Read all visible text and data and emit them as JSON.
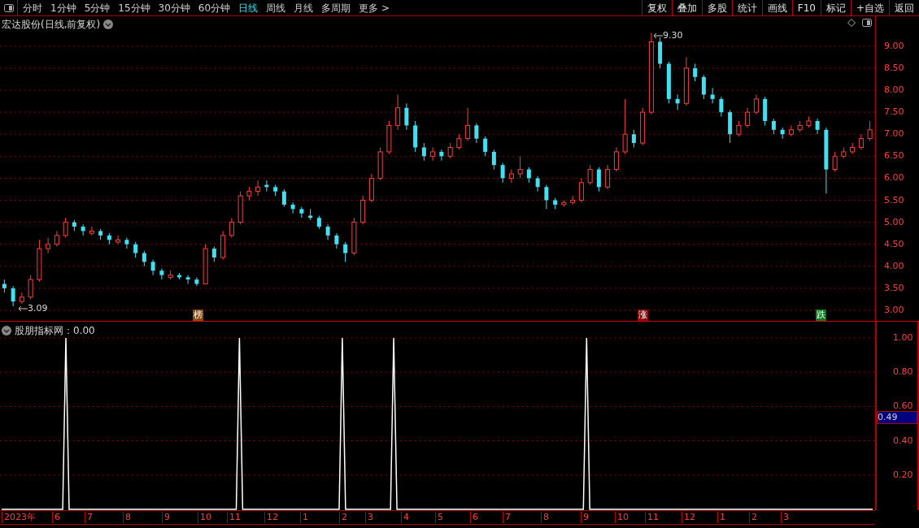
{
  "toolbar": {
    "periods": [
      {
        "label": "分时",
        "selected": false
      },
      {
        "label": "1分钟",
        "selected": false
      },
      {
        "label": "5分钟",
        "selected": false
      },
      {
        "label": "15分钟",
        "selected": false
      },
      {
        "label": "30分钟",
        "selected": false
      },
      {
        "label": "60分钟",
        "selected": false
      },
      {
        "label": "日线",
        "selected": true
      },
      {
        "label": "周线",
        "selected": false
      },
      {
        "label": "月线",
        "selected": false
      },
      {
        "label": "多周期",
        "selected": false
      },
      {
        "label": "更多 >",
        "selected": false
      }
    ],
    "actions": [
      "复权",
      "叠加",
      "多股",
      "统计",
      "画线",
      "F10",
      "标记",
      "+自选",
      "返回"
    ]
  },
  "price_panel": {
    "title": "宏达股份(日线,前复权)",
    "high_label": "9.30",
    "low_label": "3.09",
    "badges": [
      {
        "text": "榜",
        "color": "#8b4a0a"
      },
      {
        "text": "涨",
        "color": "#8b0a0a"
      },
      {
        "text": "跌",
        "color": "#0a7a1a"
      }
    ],
    "chart_data": {
      "type": "candlestick",
      "ylim": [
        2.76,
        9.68
      ],
      "grid": true,
      "yticks": [
        {
          "value": 3,
          "label": "3.00"
        },
        {
          "value": 3.5,
          "label": "3.50"
        },
        {
          "value": 4,
          "label": "4.00"
        },
        {
          "value": 4.5,
          "label": "4.50"
        },
        {
          "value": 5,
          "label": "5.00"
        },
        {
          "value": 5.5,
          "label": "5.50"
        },
        {
          "value": 6,
          "label": "6.00"
        },
        {
          "value": 6.5,
          "label": "6.50"
        },
        {
          "value": 7,
          "label": "7.00"
        },
        {
          "value": 7.5,
          "label": "7.50"
        },
        {
          "value": 8,
          "label": "8.00"
        },
        {
          "value": 8.5,
          "label": "8.50"
        },
        {
          "value": 9,
          "label": "9.00"
        }
      ],
      "ohlc": [
        [
          3.6,
          3.7,
          3.4,
          3.5
        ],
        [
          3.5,
          3.55,
          3.09,
          3.2
        ],
        [
          3.2,
          3.4,
          3.15,
          3.3
        ],
        [
          3.3,
          3.8,
          3.25,
          3.7
        ],
        [
          3.7,
          4.6,
          3.65,
          4.4
        ],
        [
          4.4,
          4.65,
          4.3,
          4.5
        ],
        [
          4.5,
          4.8,
          4.45,
          4.7
        ],
        [
          4.7,
          5.1,
          4.65,
          5.0
        ],
        [
          5.0,
          5.05,
          4.8,
          4.9
        ],
        [
          4.9,
          4.95,
          4.7,
          4.8
        ],
        [
          4.75,
          4.9,
          4.7,
          4.8
        ],
        [
          4.8,
          4.85,
          4.6,
          4.7
        ],
        [
          4.7,
          4.75,
          4.5,
          4.6
        ],
        [
          4.55,
          4.7,
          4.5,
          4.6
        ],
        [
          4.6,
          4.65,
          4.4,
          4.5
        ],
        [
          4.5,
          4.55,
          4.2,
          4.3
        ],
        [
          4.3,
          4.35,
          4.0,
          4.1
        ],
        [
          4.1,
          4.15,
          3.8,
          3.9
        ],
        [
          3.9,
          3.95,
          3.7,
          3.8
        ],
        [
          3.75,
          3.9,
          3.7,
          3.8
        ],
        [
          3.8,
          3.85,
          3.7,
          3.75
        ],
        [
          3.75,
          3.8,
          3.6,
          3.7
        ],
        [
          3.7,
          3.75,
          3.55,
          3.6
        ],
        [
          3.6,
          4.5,
          3.6,
          4.4
        ],
        [
          4.4,
          4.45,
          4.1,
          4.2
        ],
        [
          4.2,
          4.8,
          4.15,
          4.7
        ],
        [
          4.7,
          5.1,
          4.65,
          5.0
        ],
        [
          5.0,
          5.7,
          4.95,
          5.6
        ],
        [
          5.6,
          5.8,
          5.5,
          5.7
        ],
        [
          5.7,
          5.95,
          5.6,
          5.8
        ],
        [
          5.85,
          5.95,
          5.7,
          5.8
        ],
        [
          5.8,
          5.85,
          5.6,
          5.7
        ],
        [
          5.7,
          5.75,
          5.35,
          5.4
        ],
        [
          5.4,
          5.45,
          5.2,
          5.3
        ],
        [
          5.3,
          5.35,
          5.1,
          5.2
        ],
        [
          5.15,
          5.3,
          5.05,
          5.1
        ],
        [
          5.1,
          5.15,
          4.85,
          4.9
        ],
        [
          4.9,
          4.95,
          4.6,
          4.7
        ],
        [
          4.7,
          4.75,
          4.4,
          4.5
        ],
        [
          4.5,
          4.55,
          4.1,
          4.3
        ],
        [
          4.3,
          5.1,
          4.25,
          5.0
        ],
        [
          5.0,
          5.6,
          4.95,
          5.5
        ],
        [
          5.5,
          6.1,
          5.45,
          6.0
        ],
        [
          6.0,
          6.7,
          5.95,
          6.6
        ],
        [
          6.6,
          7.3,
          6.55,
          7.2
        ],
        [
          7.2,
          7.9,
          7.1,
          7.6
        ],
        [
          7.6,
          7.7,
          7.1,
          7.2
        ],
        [
          7.2,
          7.3,
          6.6,
          6.7
        ],
        [
          6.7,
          6.8,
          6.4,
          6.5
        ],
        [
          6.5,
          6.7,
          6.4,
          6.6
        ],
        [
          6.6,
          6.65,
          6.4,
          6.5
        ],
        [
          6.5,
          6.8,
          6.45,
          6.7
        ],
        [
          6.7,
          7.0,
          6.65,
          6.9
        ],
        [
          6.9,
          7.6,
          6.85,
          7.2
        ],
        [
          7.2,
          7.25,
          6.8,
          6.9
        ],
        [
          6.9,
          6.95,
          6.5,
          6.6
        ],
        [
          6.6,
          6.65,
          6.2,
          6.3
        ],
        [
          6.3,
          6.35,
          5.9,
          6.0
        ],
        [
          6.0,
          6.2,
          5.9,
          6.1
        ],
        [
          6.1,
          6.5,
          6.0,
          6.2
        ],
        [
          6.2,
          6.25,
          5.9,
          6.0
        ],
        [
          6.0,
          6.05,
          5.7,
          5.8
        ],
        [
          5.8,
          5.85,
          5.3,
          5.5
        ],
        [
          5.5,
          5.55,
          5.3,
          5.4
        ],
        [
          5.4,
          5.5,
          5.35,
          5.45
        ],
        [
          5.45,
          5.6,
          5.4,
          5.5
        ],
        [
          5.5,
          6.0,
          5.45,
          5.9
        ],
        [
          5.9,
          6.3,
          5.85,
          6.2
        ],
        [
          6.2,
          6.25,
          5.7,
          5.8
        ],
        [
          5.8,
          6.3,
          5.75,
          6.2
        ],
        [
          6.2,
          6.7,
          6.15,
          6.6
        ],
        [
          6.6,
          7.8,
          6.55,
          7.0
        ],
        [
          7.0,
          7.1,
          6.7,
          6.8
        ],
        [
          6.8,
          7.6,
          6.75,
          7.5
        ],
        [
          7.5,
          9.3,
          7.45,
          9.1
        ],
        [
          9.1,
          9.2,
          8.5,
          8.6
        ],
        [
          8.6,
          8.65,
          7.7,
          7.8
        ],
        [
          7.8,
          7.9,
          7.55,
          7.7
        ],
        [
          7.7,
          8.75,
          7.65,
          8.5
        ],
        [
          8.5,
          8.6,
          8.2,
          8.3
        ],
        [
          8.3,
          8.35,
          7.8,
          7.9
        ],
        [
          7.9,
          8.05,
          7.7,
          7.8
        ],
        [
          7.8,
          7.85,
          7.4,
          7.5
        ],
        [
          7.5,
          7.55,
          6.8,
          7.0
        ],
        [
          7.0,
          7.3,
          6.95,
          7.2
        ],
        [
          7.2,
          7.6,
          7.15,
          7.5
        ],
        [
          7.5,
          7.9,
          7.45,
          7.8
        ],
        [
          7.8,
          7.85,
          7.2,
          7.3
        ],
        [
          7.3,
          7.35,
          7.0,
          7.1
        ],
        [
          7.1,
          7.15,
          6.9,
          7.0
        ],
        [
          7.0,
          7.2,
          6.95,
          7.1
        ],
        [
          7.1,
          7.3,
          7.05,
          7.2
        ],
        [
          7.2,
          7.4,
          7.15,
          7.3
        ],
        [
          7.3,
          7.35,
          7.0,
          7.1
        ],
        [
          7.1,
          7.15,
          5.65,
          6.2
        ],
        [
          6.2,
          6.6,
          6.15,
          6.5
        ],
        [
          6.5,
          6.7,
          6.45,
          6.6
        ],
        [
          6.6,
          6.8,
          6.55,
          6.7
        ],
        [
          6.7,
          7.0,
          6.65,
          6.9
        ],
        [
          6.9,
          7.3,
          6.85,
          7.1
        ]
      ]
    }
  },
  "indicator_panel": {
    "reading": "：0.00",
    "current_value": "0.49",
    "chart_data": {
      "type": "line",
      "ylim": [
        0,
        1.095
      ],
      "grid": true,
      "yticks": [
        {
          "value": 0.2,
          "label": "0.20"
        },
        {
          "value": 0.4,
          "label": "0.40"
        },
        {
          "value": 0.6,
          "label": "0.60"
        },
        {
          "value": 0.8,
          "label": "0.80"
        },
        {
          "value": 1,
          "label": "1.00"
        }
      ],
      "series": [
        {
          "name": "股朋指标网",
          "color": "#ffffff",
          "values": [
            0,
            0,
            0,
            0,
            0,
            0,
            0,
            0,
            0,
            0,
            0,
            0,
            0,
            0,
            0,
            0,
            0,
            0,
            0,
            0,
            1,
            0,
            0,
            0,
            0,
            0,
            0,
            0,
            0,
            0,
            0,
            0,
            0,
            0,
            0,
            0,
            0,
            0,
            0,
            0,
            0,
            0,
            0,
            0,
            0,
            0,
            0,
            0,
            0,
            0,
            0,
            0,
            0,
            0,
            0,
            0,
            0,
            0,
            0,
            0,
            0,
            0,
            0,
            0,
            0,
            0,
            0,
            0,
            0,
            0,
            0,
            0,
            0,
            0,
            1,
            0,
            0,
            0,
            0,
            0,
            0,
            0,
            0,
            0,
            0,
            0,
            0,
            0,
            0,
            0,
            0,
            0,
            0,
            0,
            0,
            0,
            0,
            0,
            0,
            0,
            0,
            0,
            0,
            0,
            0,
            0,
            1,
            0,
            0,
            0,
            0,
            0,
            0,
            0,
            0,
            0,
            0,
            0,
            0,
            0,
            0,
            0,
            1,
            0,
            0,
            0,
            0,
            0,
            0,
            0,
            0,
            0,
            0,
            0,
            0,
            0,
            0,
            0,
            0,
            0,
            0,
            0,
            0,
            0,
            0,
            0,
            0,
            0,
            0,
            0,
            0,
            0,
            0,
            0,
            0,
            0,
            0,
            0,
            0,
            0,
            0,
            0,
            0,
            0,
            0,
            0,
            0,
            0,
            0,
            0,
            0,
            0,
            0,
            0,
            0,
            0,
            0,
            0,
            0,
            0,
            0,
            0,
            1,
            0,
            0,
            0,
            0,
            0,
            0,
            0,
            0,
            0,
            0,
            0,
            0,
            0,
            0,
            0,
            0,
            0,
            0,
            0,
            0,
            0,
            0,
            0,
            0,
            0,
            0,
            0,
            0,
            0,
            0,
            0,
            0,
            0,
            0,
            0,
            0,
            0,
            0,
            0,
            0,
            0,
            0,
            0,
            0,
            0,
            0,
            0,
            0,
            0,
            0,
            0,
            0,
            0,
            0,
            0,
            0,
            0,
            0,
            0,
            0,
            0,
            0,
            0,
            0,
            0,
            0,
            0,
            0,
            0,
            0,
            0,
            0,
            0,
            0,
            0,
            0,
            0,
            0,
            0,
            0,
            0,
            0,
            0,
            0,
            0,
            0,
            0,
            0,
            0
          ]
        }
      ]
    }
  },
  "date_axis": [
    "2023年",
    "6",
    "7",
    "8",
    "9",
    "10",
    "11",
    "12",
    "1",
    "2",
    "3",
    "4",
    "5",
    "6",
    "7",
    "8",
    "9",
    "10",
    "11",
    "12",
    "1",
    "2",
    "3"
  ]
}
